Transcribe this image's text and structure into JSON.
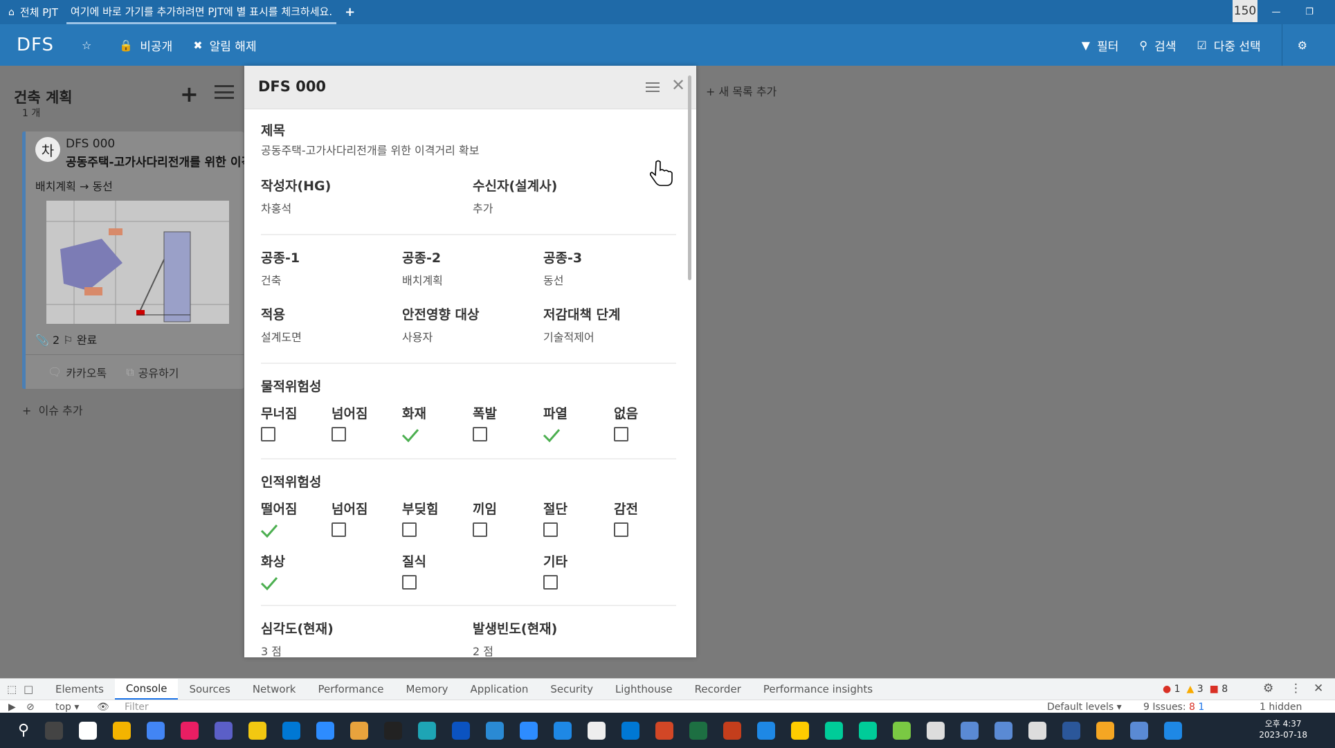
{
  "topbar": {
    "home_label": "전체 PJT",
    "hint": "여기에 바로 가기를 추가하려면 PJT에 별 표시를 체크하세요.",
    "zoom": "150"
  },
  "header": {
    "logo": "DFS",
    "private_label": "비공개",
    "mute_label": "알림 해제",
    "filter_label": "필터",
    "search_label": "검색",
    "multiselect_label": "다중 선택"
  },
  "column": {
    "title": "건축 계획",
    "count": "1 개",
    "add_issue": "이슈 추가"
  },
  "add_list": "새 목록 추가",
  "card": {
    "avatar": "차",
    "code": "DFS 000",
    "title": "공동주택-고가사다리전개를 위한 이격거리 확보",
    "path": "배치계획 → 동선",
    "attach_count": "2",
    "status": "완료",
    "kakao": "카카오톡",
    "share": "공유하기"
  },
  "panel": {
    "title": "DFS 000",
    "subject_label": "제목",
    "subject_value": "공동주택-고가사다리전개를 위한 이격거리 확보",
    "author_label": "작성자(HG)",
    "author_value": "차홍석",
    "receiver_label": "수신자(설계사)",
    "receiver_value": "추가",
    "type1_label": "공종-1",
    "type1_value": "건축",
    "type2_label": "공종-2",
    "type2_value": "배치계획",
    "type3_label": "공종-3",
    "type3_value": "동선",
    "apply_label": "적용",
    "apply_value": "설계도면",
    "safety_label": "안전영향 대상",
    "safety_value": "사용자",
    "measure_label": "저감대책 단계",
    "measure_value": "기술적제어",
    "physical_label": "물적위험성",
    "physical": [
      {
        "label": "무너짐",
        "checked": false
      },
      {
        "label": "넘어짐",
        "checked": false
      },
      {
        "label": "화재",
        "checked": true
      },
      {
        "label": "폭발",
        "checked": false
      },
      {
        "label": "파열",
        "checked": true
      },
      {
        "label": "없음",
        "checked": false
      }
    ],
    "human_label": "인적위험성",
    "human": [
      {
        "label": "떨어짐",
        "checked": true
      },
      {
        "label": "넘어짐",
        "checked": false
      },
      {
        "label": "부딪힘",
        "checked": false
      },
      {
        "label": "끼임",
        "checked": false
      },
      {
        "label": "절단",
        "checked": false
      },
      {
        "label": "감전",
        "checked": false
      },
      {
        "label": "화상",
        "checked": true
      },
      {
        "label": "질식",
        "checked": false
      },
      {
        "label": "기타",
        "checked": false
      }
    ],
    "severity_label": "심각도(현재)",
    "severity_value": "3 점",
    "frequency_label": "발생빈도(현재)",
    "frequency_value": "2 점"
  },
  "devtools": {
    "tabs": [
      "Elements",
      "Console",
      "Sources",
      "Network",
      "Performance",
      "Memory",
      "Application",
      "Security",
      "Lighthouse",
      "Recorder",
      "Performance insights"
    ],
    "active_tab": "Console",
    "context": "top",
    "filter_placeholder": "Filter",
    "levels": "Default levels",
    "issues": "9 Issues:",
    "issues_red": "8",
    "issues_blue": "1",
    "hidden": "1 hidden",
    "err_count": "1",
    "warn_count": "3",
    "msg_count": "8"
  },
  "taskbar": {
    "time": "오후 4:37",
    "date": "2023-07-18"
  },
  "colors": {
    "topbar": "#1f6aa8",
    "header": "#2878b8",
    "check": "#4caf50"
  }
}
